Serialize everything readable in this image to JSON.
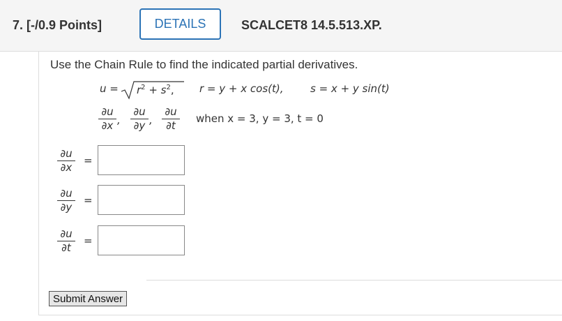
{
  "header": {
    "question_number": "7.",
    "points": "[-/0.9 Points]",
    "details_label": "DETAILS",
    "code": "SCALCET8 14.5.513.XP."
  },
  "problem": {
    "instruction": "Use the Chain Rule to find the indicated partial derivatives.",
    "u_lhs": "u =",
    "radicand_r": "r",
    "radicand_plus": " + s",
    "radicand_comma": ",",
    "exp2": "2",
    "r_def": "r = y + x cos(t),",
    "s_def": "s = x + y sin(t)",
    "targets": [
      {
        "num": "∂u",
        "den": "∂x",
        "sep": ","
      },
      {
        "num": "∂u",
        "den": "∂y",
        "sep": ","
      },
      {
        "num": "∂u",
        "den": "∂t",
        "sep": ""
      }
    ],
    "when": "when x = 3,  y = 3,  t = 0"
  },
  "answers": [
    {
      "num": "∂u",
      "den": "∂x",
      "eq": "=",
      "value": ""
    },
    {
      "num": "∂u",
      "den": "∂y",
      "eq": "=",
      "value": ""
    },
    {
      "num": "∂u",
      "den": "∂t",
      "eq": "=",
      "value": ""
    }
  ],
  "submit_label": "Submit Answer",
  "colors": {
    "accent": "#2b73b6",
    "header_bg": "#f5f5f5",
    "text": "#333333",
    "border": "#dddddd"
  }
}
